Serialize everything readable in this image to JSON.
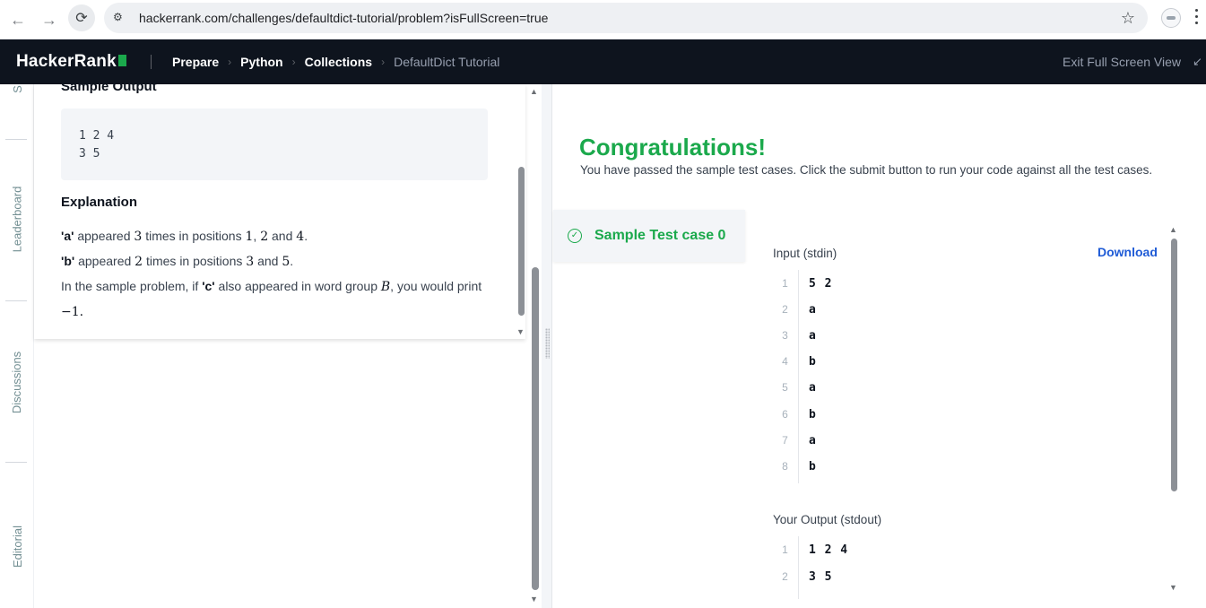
{
  "browser": {
    "url": "hackerrank.com/challenges/defaultdict-tutorial/problem?isFullScreen=true",
    "icons": [
      "back-icon",
      "forward-icon",
      "reload-icon",
      "site-settings-icon",
      "star-icon",
      "profile-icon",
      "kebab-menu-icon"
    ]
  },
  "header": {
    "logo": "HackerRank",
    "breadcrumbs": [
      "Prepare",
      "Python",
      "Collections",
      "DefaultDict Tutorial"
    ],
    "exit_label": "Exit Full Screen View"
  },
  "side_tabs": {
    "top_partial": "S",
    "leaderboard": "Leaderboard",
    "discussions": "Discussions",
    "editorial": "Editorial"
  },
  "problem": {
    "sample_output_title": "Sample Output",
    "sample_output_lines": [
      "1 2 4",
      "3 5"
    ],
    "explanation_title": "Explanation",
    "line1": {
      "pre": "'a'",
      "mid1": " appeared ",
      "count": "3",
      "mid2": " times in positions ",
      "p1": "1",
      "comma": ", ",
      "p2": "2",
      "and": " and ",
      "p3": "4",
      "end": "."
    },
    "line2": {
      "pre": "'b'",
      "mid1": " appeared ",
      "count": "2",
      "mid2": " times in positions ",
      "p1": "3",
      "and": " and ",
      "p2": "5",
      "end": "."
    },
    "line3": {
      "pre": "In the sample problem, if ",
      "c": "'c'",
      "mid": " also appeared in word group ",
      "group": "B",
      "post": ", you would print"
    },
    "line4": "−1."
  },
  "result": {
    "title": "Congratulations!",
    "subtitle": "You have passed the sample test cases. Click the submit button to run your code against all the test cases.",
    "testcase_label": "Sample Test case 0",
    "input_label": "Input (stdin)",
    "download_label": "Download",
    "input_lines": [
      "5 2",
      "a",
      "a",
      "b",
      "a",
      "b",
      "a",
      "b"
    ],
    "output_label": "Your Output (stdout)",
    "output_lines": [
      "1 2 4",
      "3 5"
    ]
  },
  "colors": {
    "accent_green": "#1ba94c",
    "header_bg": "#0e141e",
    "link_blue": "#1f5bd6"
  }
}
